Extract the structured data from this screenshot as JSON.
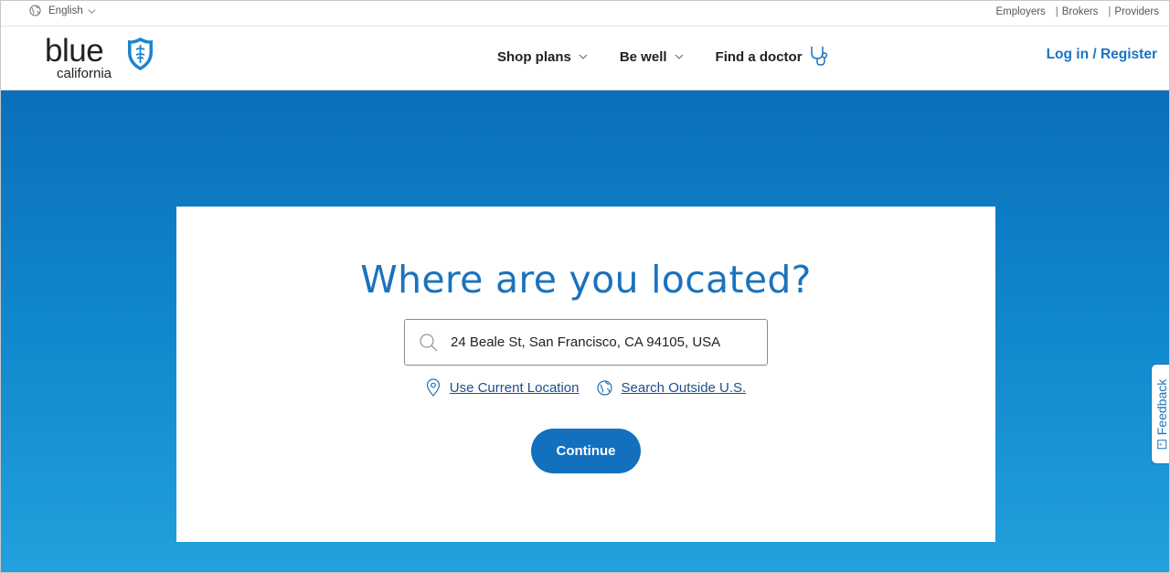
{
  "utility": {
    "language": "English",
    "links": [
      "Employers",
      "Brokers",
      "Providers"
    ]
  },
  "header": {
    "logo_word": "blue",
    "logo_sub": "california",
    "nav": [
      {
        "label": "Shop plans",
        "has_dropdown": true
      },
      {
        "label": "Be well",
        "has_dropdown": true
      },
      {
        "label": "Find a doctor",
        "icon": "stethoscope-icon"
      }
    ],
    "login": "Log in / Register"
  },
  "location_card": {
    "title": "Where are you located?",
    "search_value": "24 Beale St, San Francisco, CA 94105, USA",
    "use_current_location": "Use Current Location",
    "search_outside": "Search Outside U.S.",
    "continue": "Continue"
  },
  "feedback": "Feedback",
  "colors": {
    "brand_blue": "#1b72be",
    "hero_top": "#0a6fbb",
    "hero_bottom": "#23a0dd",
    "button": "#1270bf"
  }
}
